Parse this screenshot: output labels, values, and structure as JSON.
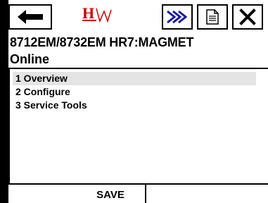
{
  "toolbar": {
    "back_icon": "left-arrow-icon",
    "logo_icon": "hart-logo-icon",
    "forward_icon": "double-chevron-right-icon",
    "document_icon": "document-icon",
    "close_icon": "close-x-icon",
    "forward_color": "#1a1aa6",
    "logo_color": "#cc0000"
  },
  "device": {
    "title": "8712EM/8732EM HR7:MAGMET",
    "status": "Online"
  },
  "menu": {
    "items": [
      {
        "label": "1 Overview",
        "selected": true
      },
      {
        "label": "2 Configure",
        "selected": false
      },
      {
        "label": "3 Service Tools",
        "selected": false
      }
    ]
  },
  "footer": {
    "save_label": "SAVE"
  }
}
